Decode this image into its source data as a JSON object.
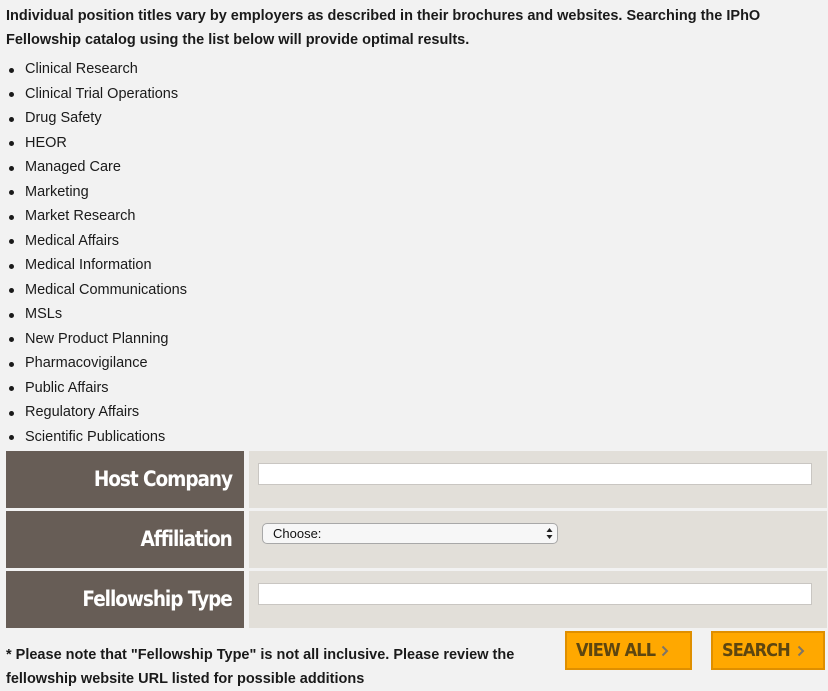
{
  "intro": {
    "text": "Individual position titles vary by employers as described in their brochures and websites. Searching the IPhO Fellowship catalog using the list below will provide optimal results."
  },
  "position_titles": [
    "Clinical Research",
    "Clinical Trial Operations",
    "Drug Safety",
    "HEOR",
    "Managed Care",
    "Marketing",
    "Market Research",
    "Medical Affairs",
    "Medical Information",
    "Medical Communications",
    "MSLs",
    "New Product Planning",
    "Pharmacovigilance",
    "Public Affairs",
    "Regulatory Affairs",
    "Scientific Publications"
  ],
  "form": {
    "host_company": {
      "label": "Host Company",
      "value": "",
      "placeholder": ""
    },
    "affiliation": {
      "label": "Affiliation",
      "selected": "Choose:"
    },
    "fellowship_type": {
      "label": "Fellowship Type",
      "value": "",
      "placeholder": ""
    }
  },
  "note": "* Please note that \"Fellowship Type\" is not all inclusive. Please review the fellowship website URL listed for possible additions",
  "buttons": {
    "view_all": "VIEW ALL",
    "search": "SEARCH",
    "icon": "chevron-right-icon"
  },
  "colors": {
    "label_bg": "#675d56",
    "field_bg": "#e2dfd9",
    "button_bg": "#ffa800",
    "button_border": "#df8f00",
    "button_text": "#5d4610"
  }
}
